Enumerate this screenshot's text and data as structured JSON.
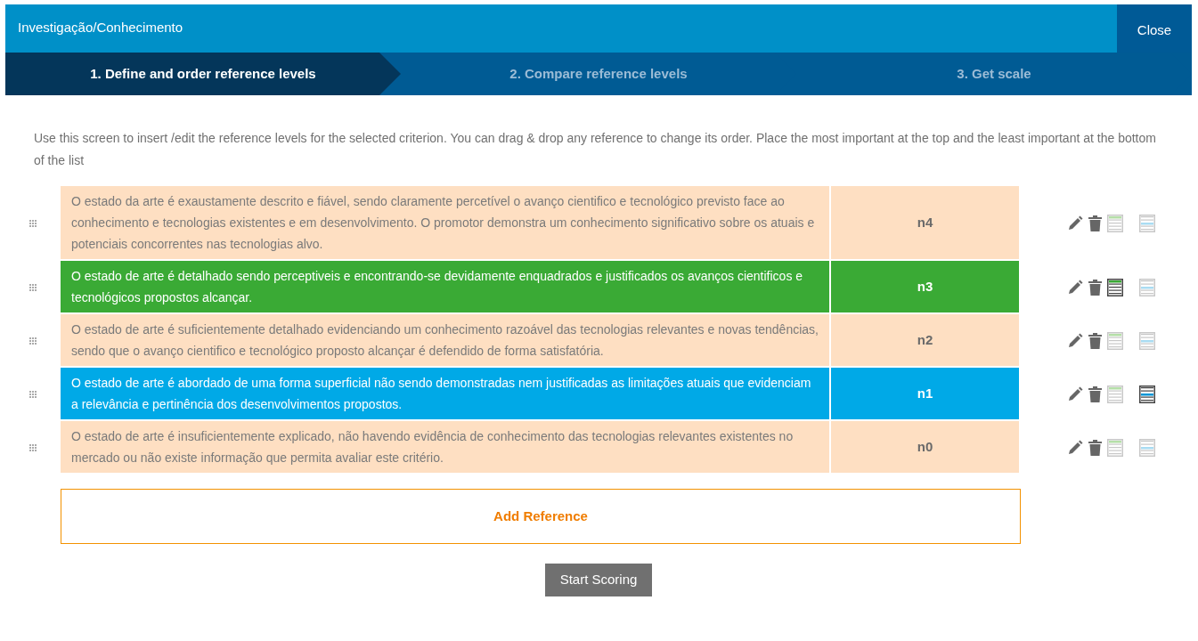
{
  "window": {
    "title": "Investigação/Conhecimento",
    "close": "Close"
  },
  "steps": [
    {
      "label": "1. Define and order reference levels",
      "selected": true
    },
    {
      "label": "2. Compare reference levels",
      "selected": false
    },
    {
      "label": "3. Get scale",
      "selected": false
    }
  ],
  "instructions": "Use this screen to insert /edit the reference levels for the selected criterion. You can drag & drop any reference to change its order. Place the most important at the top and the least important at the bottom of the list",
  "references": [
    {
      "description": "O estado da arte é exaustamente descrito e fiável, sendo claramente percetível o avanço cientifico e tecnológico previsto face ao conhecimento e tecnologias existentes e em desenvolvimento. O promotor demonstra um conhecimento significativo sobre os atuais e potenciais concorrentes nas tecnologias alvo.",
      "level": "n4",
      "good": false,
      "neutral": false
    },
    {
      "description": "O estado de arte é detalhado sendo perceptiveis e encontrando-se devidamente enquadrados e justificados os avanços cientificos e tecnológicos propostos alcançar.",
      "level": "n3",
      "good": true,
      "neutral": false
    },
    {
      "description": "O estado de arte é suficientemente detalhado evidenciando um conhecimento razoável das tecnologias relevantes e novas tendências, sendo que o avanço cientifico e tecnológico proposto alcançar é defendido de forma satisfatória.",
      "level": "n2",
      "good": false,
      "neutral": false
    },
    {
      "description": "O estado de arte é abordado de uma forma superficial não sendo demonstradas nem justificadas as limitações atuais que evidenciam a relevância e pertinência dos desenvolvimentos propostos.",
      "level": "n1",
      "good": false,
      "neutral": true
    },
    {
      "description": "O estado de arte é insuficientemente explicado, não havendo evidência de conhecimento das tecnologias relevantes existentes no mercado ou não existe informação que permita avaliar este critério.",
      "level": "n0",
      "good": false,
      "neutral": false
    }
  ],
  "add_button": "Add Reference",
  "start_button": "Start Scoring"
}
